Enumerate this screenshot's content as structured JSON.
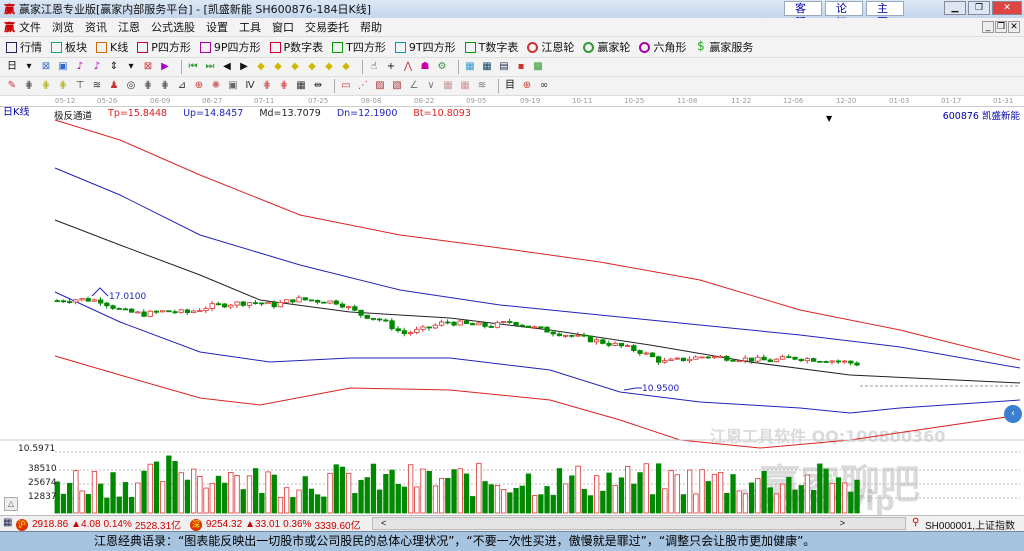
{
  "window": {
    "title": "赢家江恩专业版[赢家内部服务平台] - [凯盛新能  SH600876-184日K线]",
    "links": [
      "客服",
      "论坛",
      "主页"
    ]
  },
  "menu": [
    "文件",
    "浏览",
    "资讯",
    "江恩",
    "公式选股",
    "设置",
    "工具",
    "窗口",
    "交易委托",
    "帮助"
  ],
  "toolbar": [
    {
      "label": "行情",
      "icon": "grid-icon",
      "color": "#225"
    },
    {
      "label": "板块",
      "icon": "blocks-icon",
      "color": "#1a6"
    },
    {
      "label": "K线",
      "icon": "candles-icon",
      "color": "#c60"
    },
    {
      "label": "P四方形",
      "icon": "P-square-icon",
      "color": "#c03"
    },
    {
      "label": "9P四方形",
      "icon": "9P-square-icon",
      "color": "#a0a"
    },
    {
      "label": "P数字表",
      "icon": "PN-table-icon",
      "color": "#c03"
    },
    {
      "label": "T四方形",
      "icon": "T-square-icon",
      "color": "#090"
    },
    {
      "label": "9T四方形",
      "icon": "9T-square-icon",
      "color": "#09a"
    },
    {
      "label": "T数字表",
      "icon": "TN-table-icon",
      "color": "#090"
    },
    {
      "label": "江恩轮",
      "icon": "gann-wheel-icon",
      "color": "#c33"
    },
    {
      "label": "赢家轮",
      "icon": "winner-wheel-icon",
      "color": "#393"
    },
    {
      "label": "六角形",
      "icon": "hexagon-icon",
      "color": "#a0a"
    },
    {
      "label": "赢家服务",
      "icon": "dollar-icon",
      "color": "#2a2"
    }
  ],
  "chart": {
    "period_label": "日K线",
    "dates": [
      "05-12",
      "05-26",
      "06-09",
      "06-27",
      "07-11",
      "07-25",
      "08-08",
      "08-22",
      "09-05",
      "09-19",
      "10-11",
      "10-25",
      "11-08",
      "11-22",
      "12-06",
      "12-20",
      "01-03",
      "01-17",
      "01-31"
    ],
    "indicator": {
      "name": "极反通道",
      "tp": "Tp=15.8448",
      "up": "Up=14.8457",
      "md": "Md=13.7079",
      "dn": "Dn=12.1900",
      "bt": "Bt=10.8093"
    },
    "stock": "600876  凯盛新能",
    "high_marker": "17.0100",
    "low_marker": "10.9500",
    "price_path": [
      16.7,
      16.8,
      16.7,
      16.0,
      15.8,
      16.0,
      15.9,
      16.3,
      16.5,
      16.6,
      16.4,
      16.8,
      16.7,
      16.6,
      15.8,
      15.4,
      14.5,
      14.8,
      15.3,
      15.1,
      15.0,
      15.3,
      14.9,
      14.6,
      14.3,
      14.0,
      13.7,
      13.3,
      12.6,
      12.8,
      13.0,
      12.9,
      12.8,
      12.7,
      12.9,
      12.8,
      12.7,
      12.5
    ],
    "colors": {
      "up": "#d33",
      "down": "#080",
      "tp": "#d22",
      "up_line": "#22b",
      "md": "#222",
      "dn": "#22b",
      "bt": "#d22"
    }
  },
  "volume": {
    "labels": [
      "10.5971",
      "38510",
      "25674",
      "12837"
    ]
  },
  "status": {
    "sh": {
      "value": "2918.86",
      "change": "▲4.08",
      "pct": "0.14%",
      "amount": "2528.31亿"
    },
    "sz": {
      "value": "9254.32",
      "change": "▲33.01",
      "pct": "0.36%",
      "amount": "3339.60亿"
    },
    "index": "SH000001,上证指数"
  },
  "watermark": {
    "line1": "江恩工具软件  QQ:100800360",
    "line2": "赢家聊吧",
    "line3": "liaoba.vip"
  },
  "quote": "江恩经典语录：“图表能反映出一切股市或公司股民的总体心理状况”，“不要一次性买进，傲慢就是罪过”，“调整只会让股市更加健康”。"
}
